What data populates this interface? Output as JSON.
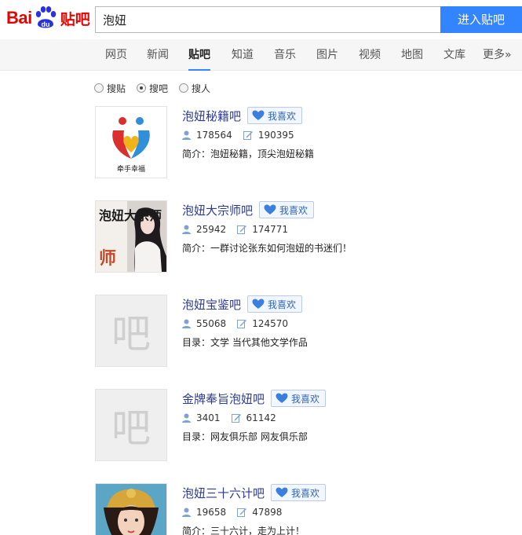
{
  "header": {
    "logo_text": "Bai",
    "logo_du": "du",
    "logo_tieba": "贴吧",
    "search_value": "泡妞",
    "search_button": "进入贴吧"
  },
  "nav": {
    "items": [
      "网页",
      "新闻",
      "贴吧",
      "知道",
      "音乐",
      "图片",
      "视频",
      "地图",
      "文库",
      "更多»"
    ],
    "active": "贴吧"
  },
  "search_type": {
    "options": [
      "搜贴",
      "搜吧",
      "搜人"
    ],
    "selected": "搜吧"
  },
  "like_label": "我喜欢",
  "results": [
    {
      "title": "泡妞秘籍吧",
      "members": "178564",
      "posts": "190395",
      "desc": "简介：泡妞秘籍，顶尖泡妞秘籍",
      "thumb": "logo-hands",
      "thumb_caption": "牵手幸福"
    },
    {
      "title": "泡妞大宗师吧",
      "members": "25942",
      "posts": "174771",
      "desc": "简介：一群讨论张东如何泡妞的书迷们！",
      "thumb": "book-cover",
      "thumb_caption": "泡妞大宗师"
    },
    {
      "title": "泡妞宝鉴吧",
      "members": "55068",
      "posts": "124570",
      "desc": "目录：文学  当代其他文学作品",
      "thumb": "placeholder",
      "thumb_caption": "吧"
    },
    {
      "title": "金牌奉旨泡妞吧",
      "members": "3401",
      "posts": "61142",
      "desc": "目录：网友俱乐部  网友俱乐部",
      "thumb": "placeholder",
      "thumb_caption": "吧"
    },
    {
      "title": "泡妞三十六计吧",
      "members": "19658",
      "posts": "47898",
      "desc": "简介：三十六计，走为上计！",
      "thumb": "character-portrait",
      "thumb_caption": ""
    }
  ],
  "colors": {
    "brand_red": "#e10601",
    "brand_blue": "#2932e1",
    "link": "#2d3999",
    "button": "#3385ff"
  },
  "icons": {
    "members": "user-icon",
    "posts": "edit-icon",
    "like": "heart-icon"
  }
}
